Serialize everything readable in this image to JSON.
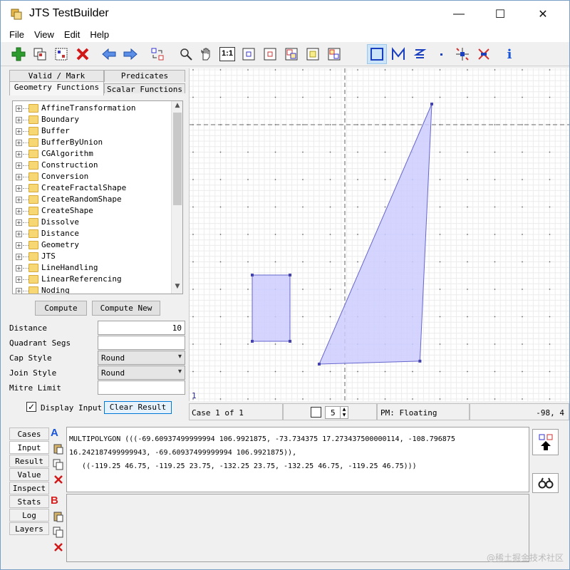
{
  "window": {
    "title": "JTS TestBuilder",
    "controls": {
      "minimize": "—",
      "maximize": "☐",
      "close": "✕"
    }
  },
  "menu": [
    "File",
    "View",
    "Edit",
    "Help"
  ],
  "toolbar": {
    "icons": [
      "add-case-icon",
      "copy-case-icon",
      "duplicate-case-icon",
      "delete-case-icon",
      "prev-case-icon",
      "next-case-icon",
      "exchange-geometries-icon",
      "zoom-icon",
      "pan-icon",
      "one-to-one-icon",
      "zoom-to-a-icon",
      "zoom-to-b-icon",
      "zoom-to-result-icon",
      "zoom-to-input-icon",
      "zoom-to-full-icon",
      "draw-polygon-icon",
      "draw-linestring-icon",
      "draw-line-icon",
      "draw-point-icon",
      "edit-vertex-icon",
      "extract-component-icon",
      "info-icon"
    ],
    "one_to_one_label": "1:1",
    "info_label": "i"
  },
  "left_tabs": {
    "row1": [
      "Valid / Mark",
      "Predicates"
    ],
    "row2": [
      "Geometry Functions",
      "Scalar Functions"
    ],
    "active": "Geometry Functions"
  },
  "function_tree": [
    "AffineTransformation",
    "Boundary",
    "Buffer",
    "BufferByUnion",
    "CGAlgorithm",
    "Construction",
    "Conversion",
    "CreateFractalShape",
    "CreateRandomShape",
    "CreateShape",
    "Dissolve",
    "Distance",
    "Geometry",
    "JTS",
    "LineHandling",
    "LinearReferencing",
    "Noding"
  ],
  "compute": {
    "compute_label": "Compute",
    "compute_new_label": "Compute New"
  },
  "params": {
    "distance_label": "Distance",
    "distance_value": "10",
    "quadrant_label": "Quadrant Segs",
    "quadrant_value": "",
    "cap_label": "Cap Style",
    "cap_value": "Round",
    "join_label": "Join Style",
    "join_value": "Round",
    "mitre_label": "Mitre Limit",
    "mitre_value": ""
  },
  "display_input": {
    "label": "Display Input",
    "checked": "✓"
  },
  "clear_result_label": "Clear Result",
  "canvas": {
    "corner_label": "1",
    "fill": "#ccccff",
    "stroke": "#6666cc"
  },
  "status": {
    "case_label": "Case 1 of 1",
    "precision_value": "5",
    "pm_label": "PM: Floating",
    "coords": "-98, 4"
  },
  "bottom_tabs": [
    "Cases",
    "Input",
    "Result",
    "Value",
    "Inspect",
    "Stats",
    "Log",
    "Layers"
  ],
  "bottom_active": "Input",
  "geometry": {
    "a_label": "A",
    "b_label": "B",
    "a_color": "#1a56db",
    "b_color": "#d61f1f",
    "wkt_a": "MULTIPOLYGON (((-69.60937499999994 106.9921875, -73.734375 17.273437500000114, -108.796875\n16.242187499999943, -69.60937499999994 106.9921875)),\n   ((-119.25 46.75, -119.25 23.75, -132.25 23.75, -132.25 46.75, -119.25 46.75)))"
  },
  "watermark": "@稀土掘金技术社区"
}
